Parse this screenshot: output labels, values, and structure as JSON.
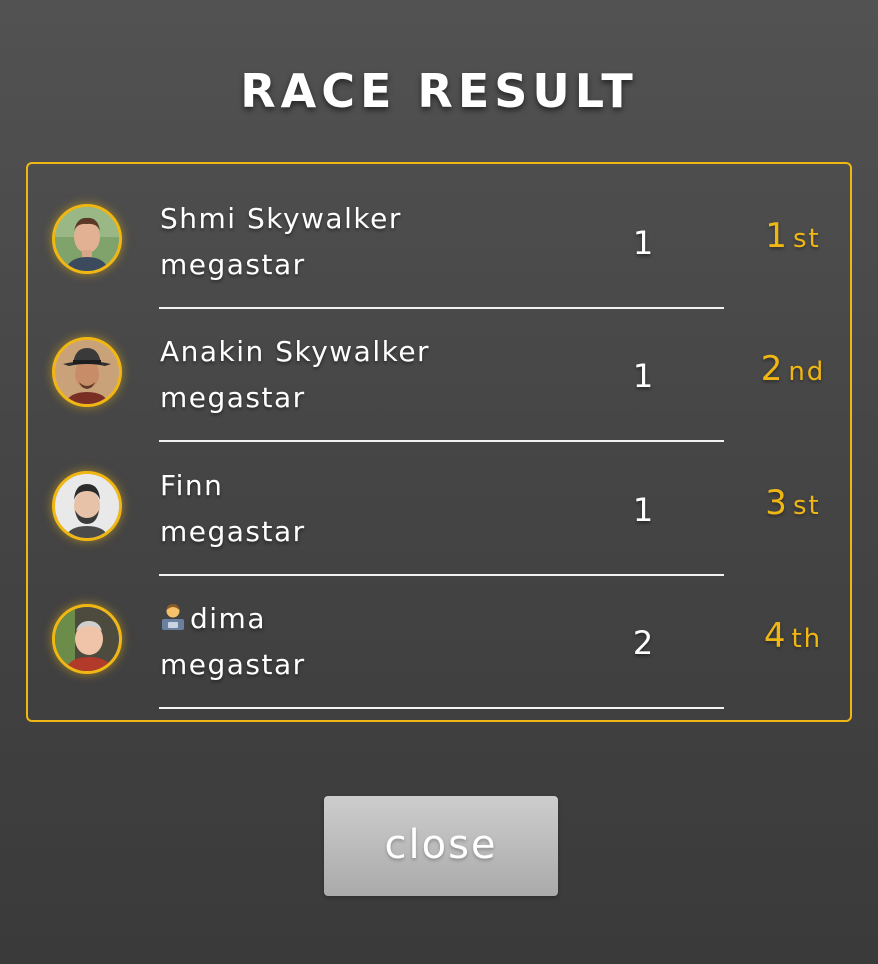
{
  "title": "RACE RESULT",
  "accent_color": "#f0b713",
  "results": [
    {
      "name": "Shmi Skywalker",
      "subtitle": "megastar",
      "score": "1",
      "place_number": "1",
      "place_suffix": "st",
      "avatar": "person-photo"
    },
    {
      "name": "Anakin Skywalker",
      "subtitle": "megastar",
      "score": "1",
      "place_number": "2",
      "place_suffix": "nd",
      "avatar": "person-photo-hat"
    },
    {
      "name": "Finn",
      "subtitle": "megastar",
      "score": "1",
      "place_number": "3",
      "place_suffix": "st",
      "avatar": "person-photo"
    },
    {
      "name": "dima",
      "name_emoji": "technologist-emoji",
      "subtitle": "megastar",
      "score": "2",
      "place_number": "4",
      "place_suffix": "th",
      "avatar": "person-photo"
    }
  ],
  "close_label": "close"
}
